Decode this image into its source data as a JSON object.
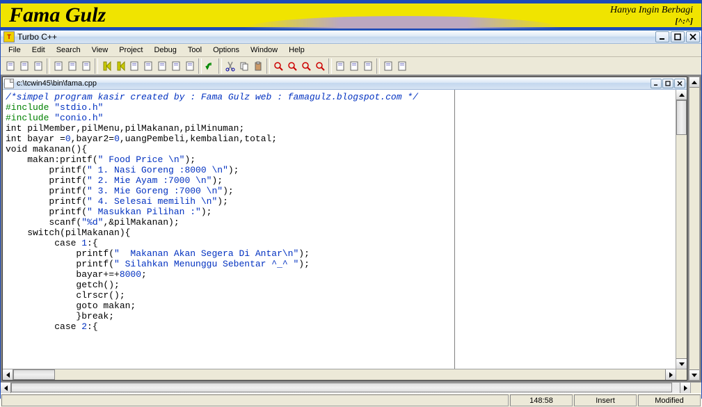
{
  "banner": {
    "logo": "Fama Gulz",
    "tagline1": "Hanya Ingin Berbagi",
    "tagline2": "[^:^]"
  },
  "window": {
    "title": "Turbo C++"
  },
  "menu": [
    "File",
    "Edit",
    "Search",
    "View",
    "Project",
    "Debug",
    "Tool",
    "Options",
    "Window",
    "Help"
  ],
  "toolbar_icons": [
    "new-file",
    "open-file",
    "save-file",
    "sep",
    "project-a",
    "project-b",
    "project-c",
    "sep",
    "run",
    "compile",
    "step-over",
    "step-into",
    "step-out",
    "trace",
    "breakpoint",
    "sep",
    "undo",
    "sep",
    "cut",
    "copy",
    "paste",
    "sep",
    "search",
    "replace",
    "search-back",
    "search-fwd",
    "sep",
    "tool-a",
    "tool-b",
    "tool-c",
    "sep",
    "window-tile",
    "window-list"
  ],
  "doc": {
    "path": "c:\\tcwin45\\bin\\fama.cpp"
  },
  "code_lines": [
    {
      "t": "comment",
      "s": "/*simpel program kasir created by : Fama Gulz web : famagulz.blogspot.com */"
    },
    {
      "t": "include",
      "pre": "#include ",
      "lit": "\"stdio.h\""
    },
    {
      "t": "include",
      "pre": "#include ",
      "lit": "\"conio.h\""
    },
    {
      "t": "plain",
      "s": "int pilMember,pilMenu,pilMakanan,pilMinuman;"
    },
    {
      "t": "mixed",
      "parts": [
        [
          "plain",
          "int bayar ="
        ],
        [
          "num",
          "0"
        ],
        [
          "plain",
          ",bayar2="
        ],
        [
          "num",
          "0"
        ],
        [
          "plain",
          ",uangPembeli,kembalian,total;"
        ]
      ]
    },
    {
      "t": "plain",
      "s": "void makanan(){"
    },
    {
      "t": "mixed",
      "parts": [
        [
          "plain",
          "    makan:printf("
        ],
        [
          "str",
          "\" Food Price \\n\""
        ],
        [
          "plain",
          ");"
        ]
      ]
    },
    {
      "t": "mixed",
      "parts": [
        [
          "plain",
          "        printf("
        ],
        [
          "str",
          "\" 1. Nasi Goreng :8000 \\n\""
        ],
        [
          "plain",
          ");"
        ]
      ]
    },
    {
      "t": "mixed",
      "parts": [
        [
          "plain",
          "        printf("
        ],
        [
          "str",
          "\" 2. Mie Ayam :7000 \\n\""
        ],
        [
          "plain",
          ");"
        ]
      ]
    },
    {
      "t": "mixed",
      "parts": [
        [
          "plain",
          "        printf("
        ],
        [
          "str",
          "\" 3. Mie Goreng :7000 \\n\""
        ],
        [
          "plain",
          ");"
        ]
      ]
    },
    {
      "t": "mixed",
      "parts": [
        [
          "plain",
          "        printf("
        ],
        [
          "str",
          "\" 4. Selesai memilih \\n\""
        ],
        [
          "plain",
          ");"
        ]
      ]
    },
    {
      "t": "mixed",
      "parts": [
        [
          "plain",
          "        printf("
        ],
        [
          "str",
          "\" Masukkan Pilihan :\""
        ],
        [
          "plain",
          ");"
        ]
      ]
    },
    {
      "t": "mixed",
      "parts": [
        [
          "plain",
          "        scanf("
        ],
        [
          "str",
          "\"%d\""
        ],
        [
          "plain",
          ",&pilMakanan);"
        ]
      ]
    },
    {
      "t": "plain",
      "s": "    switch(pilMakanan){"
    },
    {
      "t": "mixed",
      "parts": [
        [
          "plain",
          "         case "
        ],
        [
          "num",
          "1"
        ],
        [
          "plain",
          ":{"
        ]
      ]
    },
    {
      "t": "mixed",
      "parts": [
        [
          "plain",
          "             printf("
        ],
        [
          "str",
          "\"  Makanan Akan Segera Di Antar\\n\""
        ],
        [
          "plain",
          ");"
        ]
      ]
    },
    {
      "t": "mixed",
      "parts": [
        [
          "plain",
          "             printf("
        ],
        [
          "str",
          "\" Silahkan Menunggu Sebentar ^_^ \""
        ],
        [
          "plain",
          ");"
        ]
      ]
    },
    {
      "t": "mixed",
      "parts": [
        [
          "plain",
          "             bayar+=+"
        ],
        [
          "num",
          "8000"
        ],
        [
          "plain",
          ";"
        ]
      ]
    },
    {
      "t": "plain",
      "s": "             getch();"
    },
    {
      "t": "plain",
      "s": "             clrscr();"
    },
    {
      "t": "plain",
      "s": "             goto makan;"
    },
    {
      "t": "plain",
      "s": "             }break;"
    },
    {
      "t": "mixed",
      "parts": [
        [
          "plain",
          "         case "
        ],
        [
          "num",
          "2"
        ],
        [
          "plain",
          ":{"
        ]
      ]
    }
  ],
  "status": {
    "pos": "148:58",
    "insert": "Insert",
    "modified": "Modified"
  }
}
